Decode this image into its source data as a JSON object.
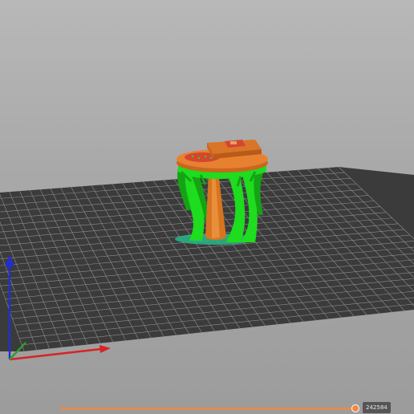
{
  "scene": {
    "model": "sliced-print-preview",
    "colors": {
      "bed_fill": "#3b3b3b",
      "bed_grid": "#8e8e8e",
      "support": "#1edc1e",
      "support_dark": "#14a314",
      "model_top": "#e8812f",
      "model_side": "#c9661f",
      "model_red": "#d64530",
      "axis_x": "#d62424",
      "axis_y": "#2ca02c",
      "axis_z": "#1f2fd6"
    }
  },
  "layer_slider": {
    "value_label": "242584",
    "position": 0.98
  }
}
